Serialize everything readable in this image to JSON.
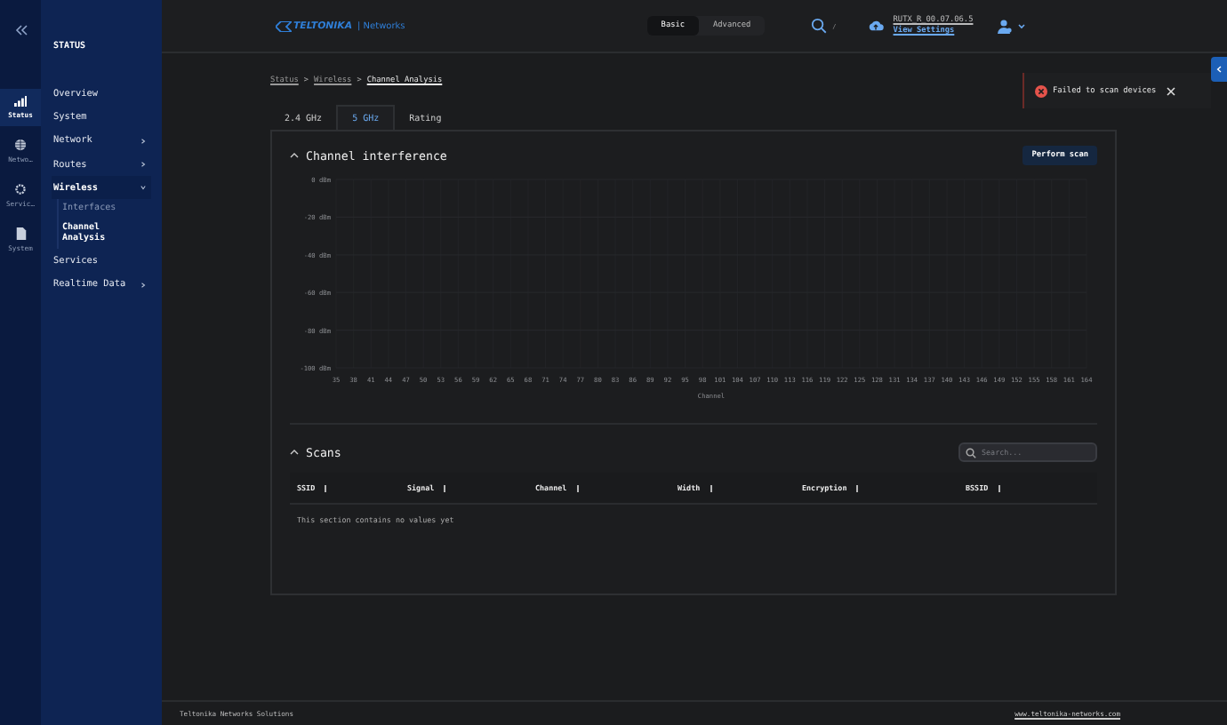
{
  "rail": [
    {
      "label": "Status",
      "kind": "signal",
      "selected": true
    },
    {
      "label": "Netwo…",
      "kind": "globe",
      "selected": false
    },
    {
      "label": "Servic…",
      "kind": "gear",
      "selected": false
    },
    {
      "label": "System",
      "kind": "file",
      "selected": false
    }
  ],
  "nav": {
    "title": "STATUS",
    "items": [
      {
        "label": "Overview",
        "arrow": false,
        "selected": false
      },
      {
        "label": "System",
        "arrow": false,
        "selected": false
      },
      {
        "label": "Network",
        "arrow": true,
        "selected": false
      },
      {
        "label": "Routes",
        "arrow": true,
        "selected": false
      },
      {
        "label": "Wireless",
        "arrow": true,
        "expanded": true,
        "selected": true,
        "children": [
          {
            "label": "Interfaces",
            "selected": false
          },
          {
            "label": "Channel Analysis",
            "selected": true
          }
        ]
      },
      {
        "label": "Services",
        "arrow": false,
        "selected": false
      },
      {
        "label": "Realtime Data",
        "arrow": true,
        "selected": false
      }
    ]
  },
  "header": {
    "brand": "TELTONIKA",
    "brand_suffix": "| Networks",
    "modes": [
      {
        "label": "Basic",
        "selected": true
      },
      {
        "label": "Advanced",
        "selected": false
      }
    ],
    "search_shortcut": "/",
    "firmware": "RUTX_R_00.07.06.5",
    "view_settings": "View Settings"
  },
  "breadcrumb": [
    {
      "label": "Status"
    },
    {
      "separator": ">",
      "label": "Wireless"
    },
    {
      "separator": ">",
      "label": "Channel Analysis"
    }
  ],
  "toast": {
    "message": "Failed to scan devices"
  },
  "tabs": [
    {
      "label": "2.4 GHz",
      "selected": false
    },
    {
      "label": "5 GHz",
      "selected": true
    },
    {
      "label": "Rating",
      "selected": false
    }
  ],
  "interference": {
    "title": "Channel interference",
    "button": "Perform scan",
    "chart_data": {
      "type": "line",
      "grid": true,
      "xlabel": "Channel",
      "ylim": [
        -100,
        0
      ],
      "yticks": [
        {
          "value": 0,
          "label": "0 dBm"
        },
        {
          "value": -20,
          "label": "-20 dBm"
        },
        {
          "value": -40,
          "label": "-40 dBm"
        },
        {
          "value": -60,
          "label": "-60 dBm"
        },
        {
          "value": -80,
          "label": "-80 dBm"
        },
        {
          "value": -100,
          "label": "-100 dBm"
        }
      ],
      "categories": [
        "35",
        "38",
        "41",
        "44",
        "47",
        "50",
        "53",
        "56",
        "59",
        "62",
        "65",
        "68",
        "71",
        "74",
        "77",
        "80",
        "83",
        "86",
        "89",
        "92",
        "95",
        "98",
        "101",
        "104",
        "107",
        "110",
        "113",
        "116",
        "119",
        "122",
        "125",
        "128",
        "131",
        "134",
        "137",
        "140",
        "143",
        "146",
        "149",
        "152",
        "155",
        "158",
        "161",
        "164"
      ]
    }
  },
  "scans": {
    "title": "Scans",
    "search_placeholder": "Search...",
    "columns": [
      "SSID",
      "Signal",
      "Channel",
      "Width",
      "Encryption",
      "BSSID"
    ],
    "empty": "This section contains no values yet"
  },
  "footer": {
    "left": "Teltonika Networks Solutions",
    "right": "www.teltonika-networks.com"
  }
}
